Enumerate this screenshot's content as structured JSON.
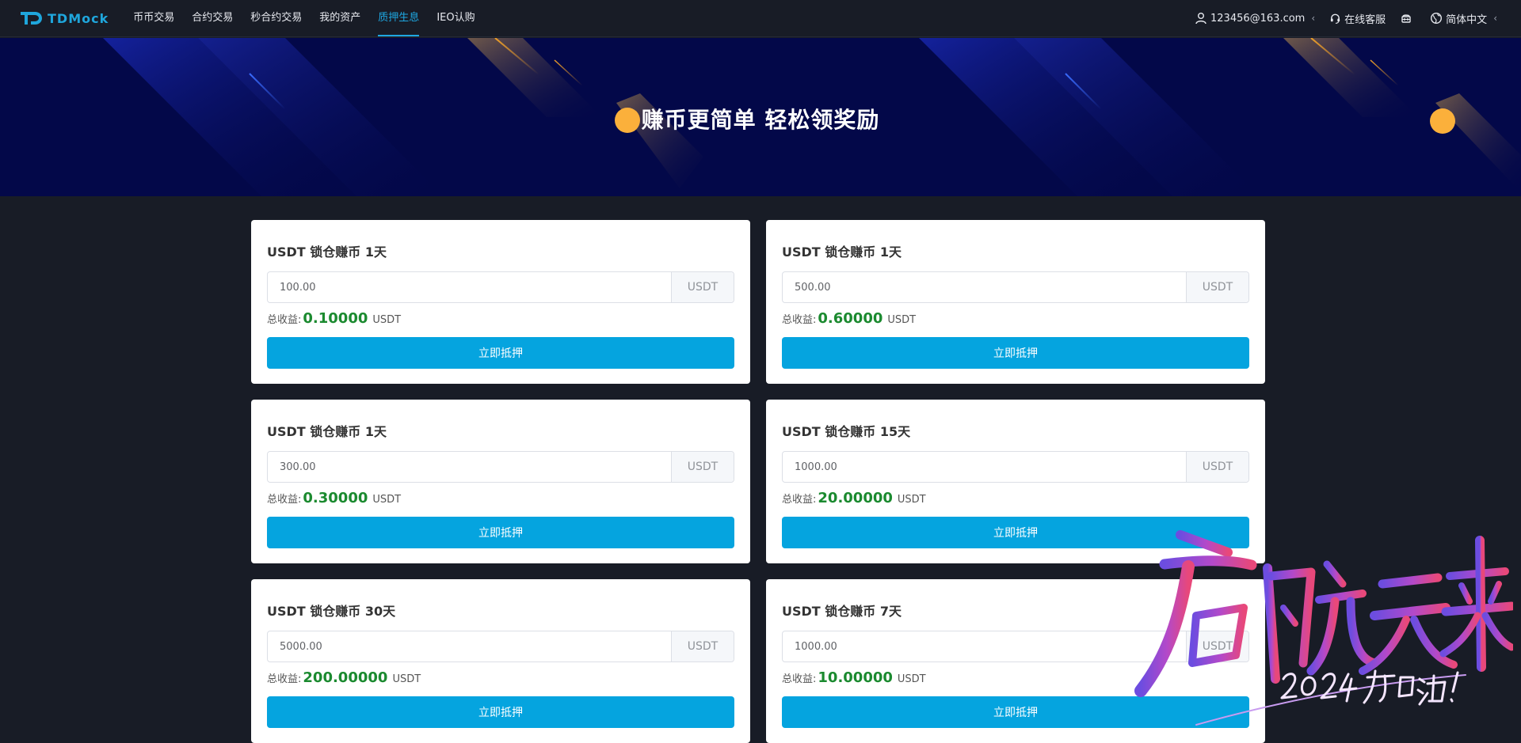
{
  "brand": {
    "name": "TDMock"
  },
  "nav": {
    "items": [
      {
        "label": "币币交易",
        "active": false
      },
      {
        "label": "合约交易",
        "active": false
      },
      {
        "label": "秒合约交易",
        "active": false
      },
      {
        "label": "我的资产",
        "active": false
      },
      {
        "label": "质押生息",
        "active": true
      },
      {
        "label": "IEO认购",
        "active": false
      }
    ]
  },
  "header": {
    "account": "123456@163.com",
    "support": "在线客服",
    "language": "简体中文"
  },
  "banner": {
    "title": "赚币更简单 轻松领奖励"
  },
  "colors": {
    "accent": "#05a4df",
    "income": "#1b8a2f",
    "banner_bg": "#030849",
    "page_bg": "#181c26"
  },
  "cards": [
    {
      "title": "USDT 锁仓赚币 1天",
      "amount": "100.00",
      "unit": "USDT",
      "income_label": "总收益:",
      "income": "0.10000",
      "income_unit": "USDT",
      "button": "立即抵押"
    },
    {
      "title": "USDT 锁仓赚币 1天",
      "amount": "500.00",
      "unit": "USDT",
      "income_label": "总收益:",
      "income": "0.60000",
      "income_unit": "USDT",
      "button": "立即抵押"
    },
    {
      "title": "USDT 锁仓赚币 1天",
      "amount": "300.00",
      "unit": "USDT",
      "income_label": "总收益:",
      "income": "0.30000",
      "income_unit": "USDT",
      "button": "立即抵押"
    },
    {
      "title": "USDT 锁仓赚币 15天",
      "amount": "1000.00",
      "unit": "USDT",
      "income_label": "总收益:",
      "income": "20.00000",
      "income_unit": "USDT",
      "button": "立即抵押"
    },
    {
      "title": "USDT 锁仓赚币 30天",
      "amount": "5000.00",
      "unit": "USDT",
      "income_label": "总收益:",
      "income": "200.00000",
      "income_unit": "USDT",
      "button": "立即抵押"
    },
    {
      "title": "USDT 锁仓赚币 7天",
      "amount": "1000.00",
      "unit": "USDT",
      "income_label": "总收益:",
      "income": "10.00000",
      "income_unit": "USDT",
      "button": "立即抵押"
    }
  ],
  "watermark": {
    "main": "启航未来",
    "sub": "2024加油!"
  }
}
